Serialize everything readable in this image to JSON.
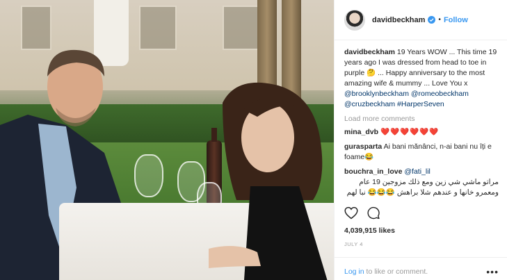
{
  "colors": {
    "accent": "#3897f0",
    "heart": "#ed4956",
    "muted": "#999999",
    "link": "#003569"
  },
  "header": {
    "username": "davidbeckham",
    "separator": "•",
    "follow_label": "Follow"
  },
  "caption": {
    "username": "davidbeckham",
    "text": "19 Years WOW ... This time 19 years ago I was dressed from head to toe in purple 🤔 ... Happy anniversary to the most amazing wife & mummy ... Love You x",
    "mentions": [
      "@brooklynbeckham",
      "@romeobeckham",
      "@cruzbeckham"
    ],
    "hashtag": "#HarperSeven"
  },
  "load_more_label": "Load more comments",
  "comments": [
    {
      "user": "mina_dvb",
      "text": "❤️❤️❤️❤️❤️❤️"
    },
    {
      "user": "gurasparta",
      "text": "Ai bani mănânci, n-ai bani nu îți e foame😂"
    },
    {
      "user": "bouchra_in_love",
      "mention": "@fati_lil",
      "text": "مراتو ماشي شي زين ومع ذلك مزوجين 19 عام ومعمرو خانها و عندهم شلا براهش 😂😂😂 نبا لهم"
    }
  ],
  "actions": {
    "like_icon": "heart-outline-icon",
    "comment_icon": "comment-bubble-icon"
  },
  "likes": "4,039,915 likes",
  "date": "JULY 4",
  "footer": {
    "login_label": "Log in",
    "suffix": " to like or comment.",
    "more_icon": "ellipsis-icon"
  }
}
